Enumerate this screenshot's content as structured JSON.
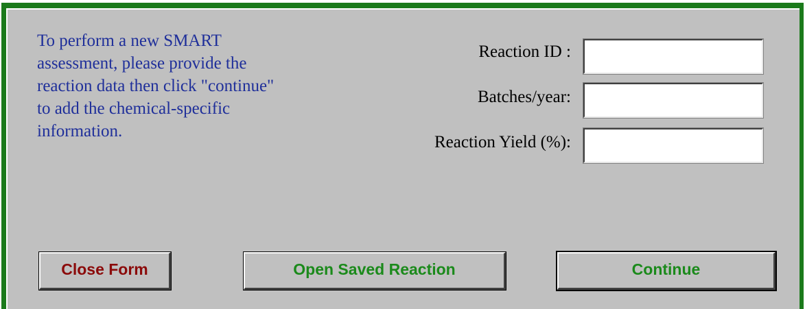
{
  "intro": {
    "lines": [
      "To perform a new SMART",
      "assessment, please provide the",
      "reaction data then click \"continue\"",
      "to add the chemical-specific",
      "information."
    ]
  },
  "fields": {
    "reaction_id": {
      "label": "Reaction ID :",
      "value": ""
    },
    "batches_per_year": {
      "label": "Batches/year:",
      "value": ""
    },
    "reaction_yield": {
      "label": "Reaction Yield (%):",
      "value": ""
    }
  },
  "buttons": {
    "close_form": "Close Form",
    "open_saved_reaction": "Open Saved Reaction",
    "continue": "Continue"
  },
  "colors": {
    "frame": "#1b7a1b",
    "background": "#c0c0c0",
    "intro_text": "#1f2f9a",
    "close_button_text": "#8b0a0a",
    "green_button_text": "#1b8a1b"
  }
}
